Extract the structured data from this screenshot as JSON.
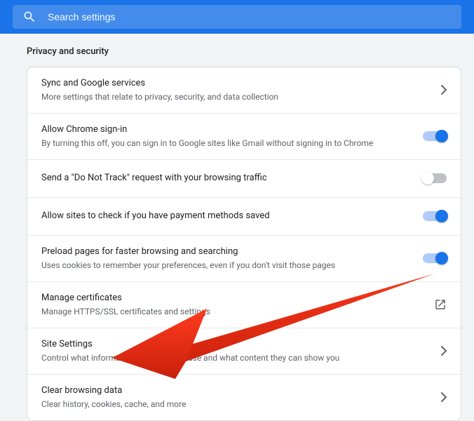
{
  "header": {
    "search_placeholder": "Search settings"
  },
  "section": {
    "title": "Privacy and security"
  },
  "rows": [
    {
      "title": "Sync and Google services",
      "sub": "More settings that relate to privacy, security, and data collection",
      "action": "chevron"
    },
    {
      "title": "Allow Chrome sign-in",
      "sub": "By turning this off, you can sign in to Google sites like Gmail without signing in to Chrome",
      "action": "toggle",
      "on": true
    },
    {
      "title": "Send a \"Do Not Track\" request with your browsing traffic",
      "sub": "",
      "action": "toggle",
      "on": false
    },
    {
      "title": "Allow sites to check if you have payment methods saved",
      "sub": "",
      "action": "toggle",
      "on": true
    },
    {
      "title": "Preload pages for faster browsing and searching",
      "sub": "Uses cookies to remember your preferences, even if you don't visit those pages",
      "action": "toggle",
      "on": true
    },
    {
      "title": "Manage certificates",
      "sub": "Manage HTTPS/SSL certificates and settings",
      "action": "external"
    },
    {
      "title": "Site Settings",
      "sub": "Control what information websites can use and what content they can show you",
      "action": "chevron"
    },
    {
      "title": "Clear browsing data",
      "sub": "Clear history, cookies, cache, and more",
      "action": "chevron"
    }
  ]
}
